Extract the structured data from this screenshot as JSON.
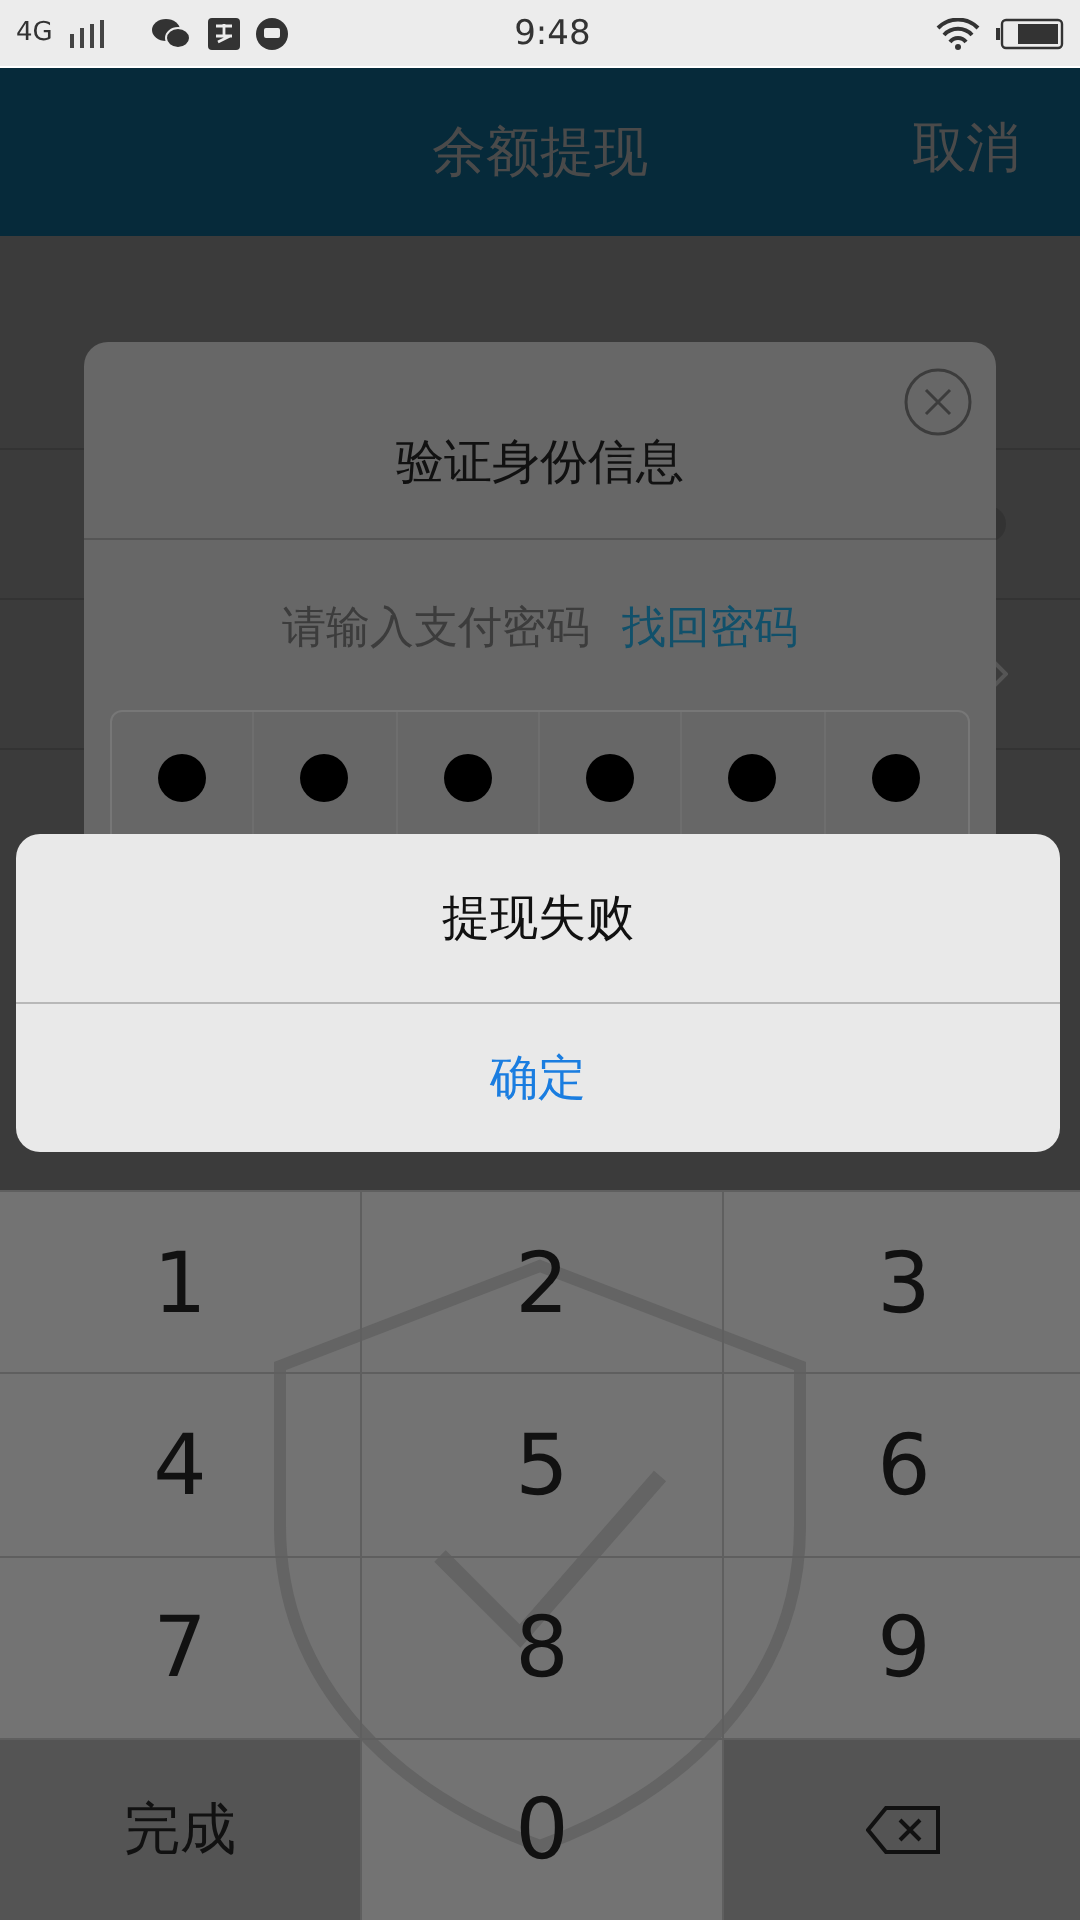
{
  "status_bar": {
    "network": "4G",
    "time": "9:48"
  },
  "header": {
    "title": "余额提现",
    "action": "取消"
  },
  "page": {
    "rows": [
      {
        "kind": "clear"
      },
      {
        "kind": "chevron"
      }
    ]
  },
  "dialog": {
    "title": "验证身份信息",
    "prompt": "请输入支付密码",
    "link": "找回密码",
    "pin_cells": [
      {
        "filled": true
      },
      {
        "filled": true
      },
      {
        "filled": true
      },
      {
        "filled": true
      },
      {
        "filled": true
      },
      {
        "filled": true
      }
    ]
  },
  "alert": {
    "message": "提现失败",
    "button": "确定"
  },
  "keypad": {
    "keys": [
      {
        "kind": "digit",
        "label": "1"
      },
      {
        "kind": "digit",
        "label": "2"
      },
      {
        "kind": "digit",
        "label": "3"
      },
      {
        "kind": "digit",
        "label": "4"
      },
      {
        "kind": "digit",
        "label": "5"
      },
      {
        "kind": "digit",
        "label": "6"
      },
      {
        "kind": "digit",
        "label": "7"
      },
      {
        "kind": "digit",
        "label": "8"
      },
      {
        "kind": "digit",
        "label": "9"
      },
      {
        "kind": "action",
        "label": "完成"
      },
      {
        "kind": "digit",
        "label": "0"
      },
      {
        "kind": "delete"
      }
    ]
  }
}
